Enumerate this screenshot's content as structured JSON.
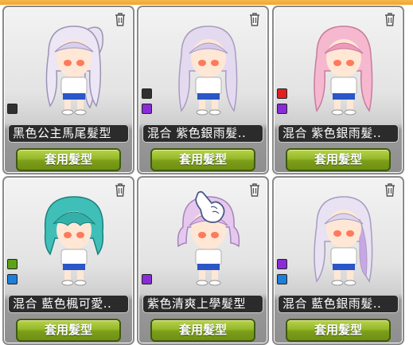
{
  "colors": {
    "black": "#303030",
    "purple": "#8a2bd8",
    "red": "#e02020",
    "green": "#5ca21a",
    "blue": "#1e7fd8"
  },
  "hairstyles": [
    {
      "name": "黑色公主馬尾髮型",
      "button": "套用髮型",
      "hair": "lavender-white",
      "swatches": [
        "black"
      ]
    },
    {
      "name": "混合  紫色銀雨髮..",
      "button": "套用髮型",
      "hair": "light-purple",
      "swatches": [
        "black",
        "purple"
      ]
    },
    {
      "name": "混合  紫色銀雨髮..",
      "button": "套用髮型",
      "hair": "pink",
      "swatches": [
        "red",
        "purple"
      ]
    },
    {
      "name": "混合  藍色楓可愛..",
      "button": "套用髮型",
      "hair": "teal",
      "swatches": [
        "green",
        "blue"
      ]
    },
    {
      "name": "紫色清爽上學髮型",
      "button": "套用髮型",
      "hair": "light-purple",
      "swatches": [
        "purple"
      ]
    },
    {
      "name": "混合  藍色銀雨髮..",
      "button": "套用髮型",
      "hair": "lavender-white",
      "swatches": [
        "purple",
        "blue"
      ]
    }
  ]
}
